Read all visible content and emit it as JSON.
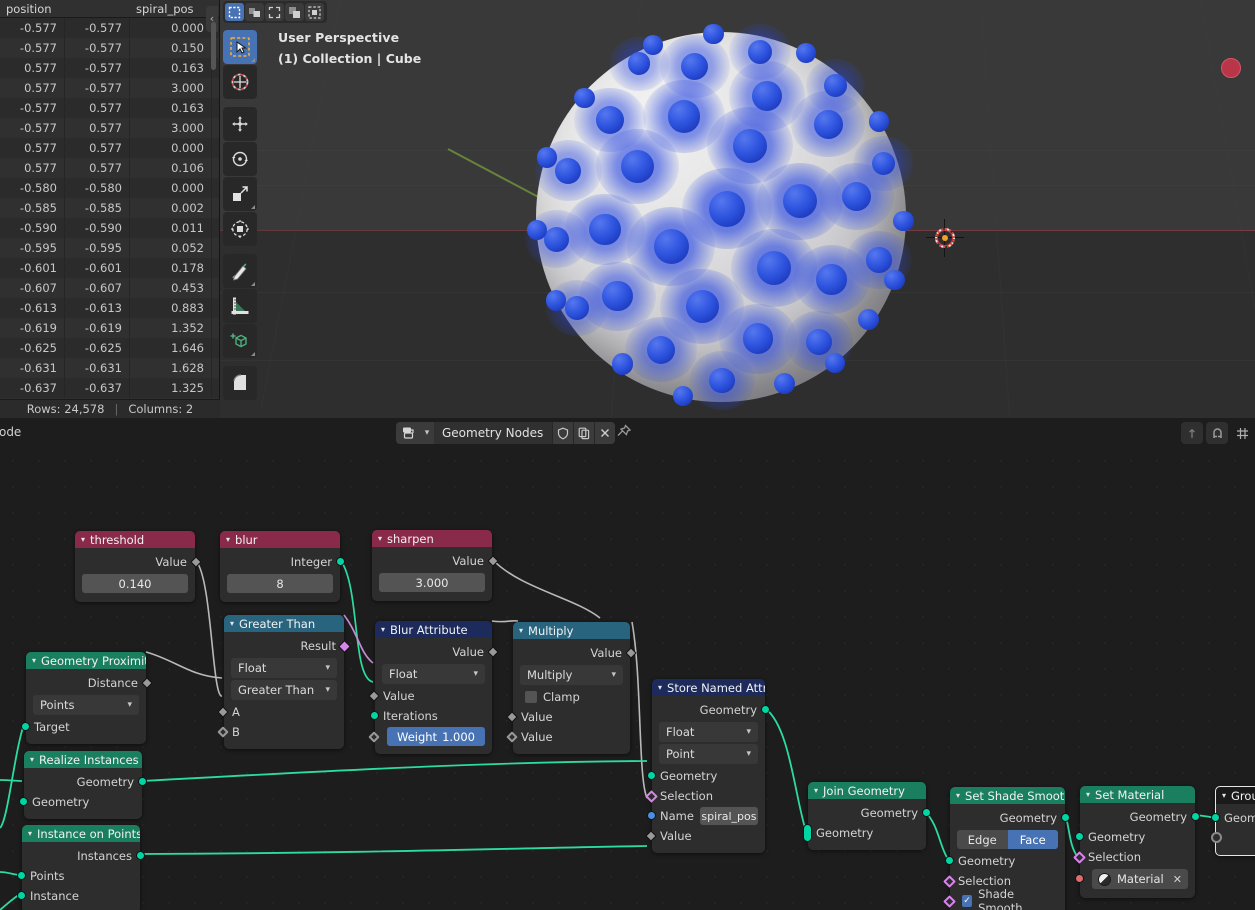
{
  "spreadsheet": {
    "columns": [
      "position",
      "spiral_pos"
    ],
    "rows": [
      [
        "-0.577",
        "-0.577",
        "0.000"
      ],
      [
        "-0.577",
        "-0.577",
        "0.150"
      ],
      [
        "0.577",
        "-0.577",
        "0.163"
      ],
      [
        "0.577",
        "-0.577",
        "3.000"
      ],
      [
        "-0.577",
        "0.577",
        "0.163"
      ],
      [
        "-0.577",
        "0.577",
        "3.000"
      ],
      [
        "0.577",
        "0.577",
        "0.000"
      ],
      [
        "0.577",
        "0.577",
        "0.106"
      ],
      [
        "-0.580",
        "-0.580",
        "0.000"
      ],
      [
        "-0.585",
        "-0.585",
        "0.002"
      ],
      [
        "-0.590",
        "-0.590",
        "0.011"
      ],
      [
        "-0.595",
        "-0.595",
        "0.052"
      ],
      [
        "-0.601",
        "-0.601",
        "0.178"
      ],
      [
        "-0.607",
        "-0.607",
        "0.453"
      ],
      [
        "-0.613",
        "-0.613",
        "0.883"
      ],
      [
        "-0.619",
        "-0.619",
        "1.352"
      ],
      [
        "-0.625",
        "-0.625",
        "1.646"
      ],
      [
        "-0.631",
        "-0.631",
        "1.628"
      ],
      [
        "-0.637",
        "-0.637",
        "1.325"
      ]
    ],
    "footer": {
      "rows_label": "Rows: 24,578",
      "separator": "|",
      "columns_label": "Columns: 2"
    },
    "collapse_glyph": "‹"
  },
  "viewport": {
    "perspective": "User Perspective",
    "scene_info": "(1) Collection | Cube",
    "select_modes": [
      "tweak-select-icon",
      "box-select-icon",
      "lasso-select-icon",
      "circle-select-icon",
      "select-all-icon"
    ],
    "tools": [
      "select-box-tool",
      "cursor-tool",
      "move-tool",
      "rotate-tool",
      "scale-tool",
      "transform-tool",
      "annotate-tool",
      "measure-tool",
      "add-cube-tool",
      "bevel-tool"
    ],
    "gizmo_axis_color": "#c5354a"
  },
  "node_editor": {
    "menu_label": "Node",
    "datablock_name": "Geometry Nodes",
    "breadcrumb": "Geometry Nodes",
    "header_buttons": [
      "fake-user-shield-icon",
      "duplicate-icon",
      "unlink-x-icon",
      "pin-icon"
    ],
    "right_buttons": [
      "parent-node-tree-icon",
      "snap-magnet-icon",
      "snap-grid-icon"
    ]
  },
  "nodes": {
    "threshold": {
      "title": "threshold",
      "color": "#8a2a4b",
      "out_label": "Value",
      "value": "0.140"
    },
    "blur": {
      "title": "blur",
      "color": "#8a2a4b",
      "out_label": "Integer",
      "value": "8"
    },
    "sharpen": {
      "title": "sharpen",
      "color": "#8a2a4b",
      "out_label": "Value",
      "value": "3.000"
    },
    "greater_than": {
      "title": "Greater Than",
      "color": "#29647f",
      "out_label": "Result",
      "data_type": "Float",
      "operation": "Greater Than",
      "inputs": [
        "A",
        "B"
      ]
    },
    "blur_attribute": {
      "title": "Blur Attribute",
      "color": "#1c2a5c",
      "out_label": "Value",
      "data_type": "Float",
      "inputs": [
        "Value",
        "Iterations"
      ],
      "weight_label": "Weight",
      "weight_value": "1.000"
    },
    "multiply": {
      "title": "Multiply",
      "color": "#29647f",
      "out_label": "Value",
      "operation": "Multiply",
      "clamp_label": "Clamp",
      "inputs": [
        "Value",
        "Value"
      ]
    },
    "store_named_attribute": {
      "title": "Store Named Attrib...",
      "color": "#1c2a5c",
      "out_label": "Geometry",
      "data_type": "Float",
      "domain": "Point",
      "inputs": [
        "Geometry",
        "Selection",
        "Name",
        "Value"
      ],
      "name_value": "spiral_pos"
    },
    "geometry_proximity": {
      "title": "Geometry Proximity",
      "color": "#1a7f5e",
      "out_label": "Distance",
      "target_element": "Points",
      "inputs": [
        "Target"
      ]
    },
    "realize_instances": {
      "title": "Realize Instances",
      "color": "#1a7f5e",
      "out_label": "Geometry",
      "inputs": [
        "Geometry"
      ]
    },
    "instance_on_points": {
      "title": "Instance on Points",
      "color": "#1a7f5e",
      "out_label": "Instances",
      "inputs": [
        "Points",
        "Instance"
      ]
    },
    "join_geometry": {
      "title": "Join Geometry",
      "color": "#1a7f5e",
      "out_label": "Geometry",
      "inputs": [
        "Geometry"
      ]
    },
    "set_shade_smooth": {
      "title": "Set Shade Smooth",
      "color": "#1a7f5e",
      "out_label": "Geometry",
      "domain_edge": "Edge",
      "domain_face": "Face",
      "inputs": [
        "Geometry",
        "Selection"
      ],
      "shade_smooth_label": "Shade Smooth",
      "shade_smooth_checked": "✓"
    },
    "set_material": {
      "title": "Set Material",
      "color": "#1a7f5e",
      "out_label": "Geometry",
      "inputs": [
        "Geometry",
        "Selection"
      ],
      "material_label": "Material",
      "material_clear": "✕"
    },
    "group_output": {
      "title": "Group",
      "color": "#1a1a1a",
      "inputs": [
        "Geometry"
      ]
    }
  }
}
